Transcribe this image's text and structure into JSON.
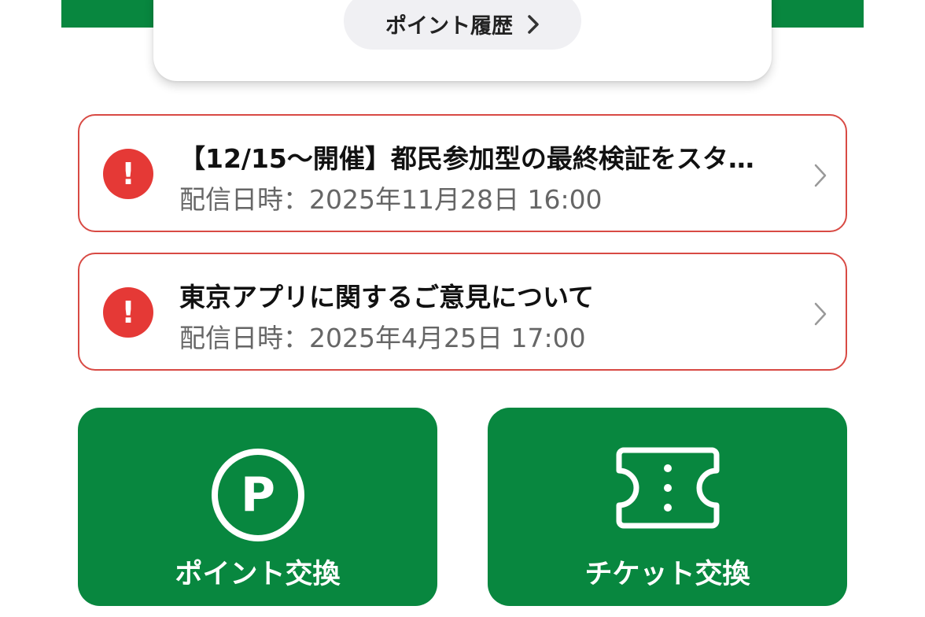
{
  "point_card": {
    "history_button_label": "ポイント履歴"
  },
  "notices": [
    {
      "title": "【12/15〜開催】都民参加型の最終検証をスタ…",
      "date": "配信日時：2025年11月28日 16:00",
      "icon": "alert-icon"
    },
    {
      "title": "東京アプリに関するご意見について",
      "date": "配信日時：2025年4月25日 17:00",
      "icon": "alert-icon"
    }
  ],
  "actions": {
    "point_exchange_label": "ポイント交換",
    "ticket_exchange_label": "チケット交換"
  },
  "colors": {
    "brand_green": "#08873f",
    "alert_red": "#e53936",
    "notice_border": "#d84a44"
  }
}
